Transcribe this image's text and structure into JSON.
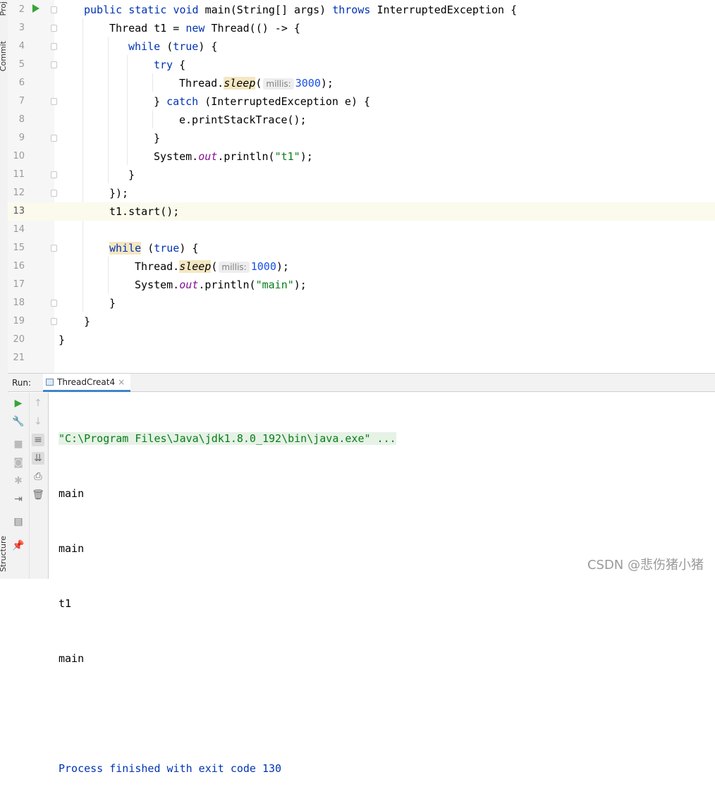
{
  "side_tabs": [
    "Proj",
    "Commit",
    "Structure"
  ],
  "editor": {
    "current_line": "13",
    "lines": [
      {
        "no": "2"
      },
      {
        "no": "3"
      },
      {
        "no": "4"
      },
      {
        "no": "5"
      },
      {
        "no": "6"
      },
      {
        "no": "7"
      },
      {
        "no": "8"
      },
      {
        "no": "9"
      },
      {
        "no": "10"
      },
      {
        "no": "11"
      },
      {
        "no": "12"
      },
      {
        "no": "13"
      },
      {
        "no": "14"
      },
      {
        "no": "15"
      },
      {
        "no": "16"
      },
      {
        "no": "17"
      },
      {
        "no": "18"
      },
      {
        "no": "19"
      },
      {
        "no": "20"
      },
      {
        "no": "21"
      }
    ],
    "tokens": {
      "kw_public": "public",
      "kw_static": "static",
      "kw_void": "void",
      "main_sig": "main(String[] args)",
      "kw_throws": "throws",
      "exc_type": "InterruptedException {",
      "l3": "Thread t1 = ",
      "kw_new": "new",
      "l3b": "Thread(() -> {",
      "kw_while": "while",
      "paren_open": "(",
      "kw_true": "true",
      "l4b": ") {",
      "kw_try": "try",
      "brace_open": "{",
      "thread_dot": "Thread.",
      "sleep": "sleep",
      "hint_millis": "millis:",
      "n3000": "3000",
      "close_semi": ");",
      "brace_close": "}",
      "kw_catch": "catch",
      "catch_rest": "(InterruptedException e) {",
      "l8": "e.printStackTrace();",
      "sys_dot": "System.",
      "out": "out",
      "println_open": ".println(",
      "s_t1": "\"t1\"",
      "l12": "});",
      "l13": "t1.start();",
      "n1000": "1000",
      "s_main": "\"main\""
    }
  },
  "run_panel": {
    "label": "Run:",
    "tab_name": "ThreadCreat4",
    "tab_close": "×",
    "output": {
      "command": "\"C:\\Program Files\\Java\\jdk1.8.0_192\\bin\\java.exe\" ...",
      "lines": [
        "main",
        "main",
        "t1",
        "main"
      ],
      "exit_message": "Process finished with exit code 130"
    }
  },
  "watermark": "CSDN @悲伤猪小猪",
  "colors": {
    "keyword": "#0033b3",
    "string": "#067d17",
    "number": "#1750eb",
    "field": "#871094",
    "run_green": "#3aa33a"
  }
}
